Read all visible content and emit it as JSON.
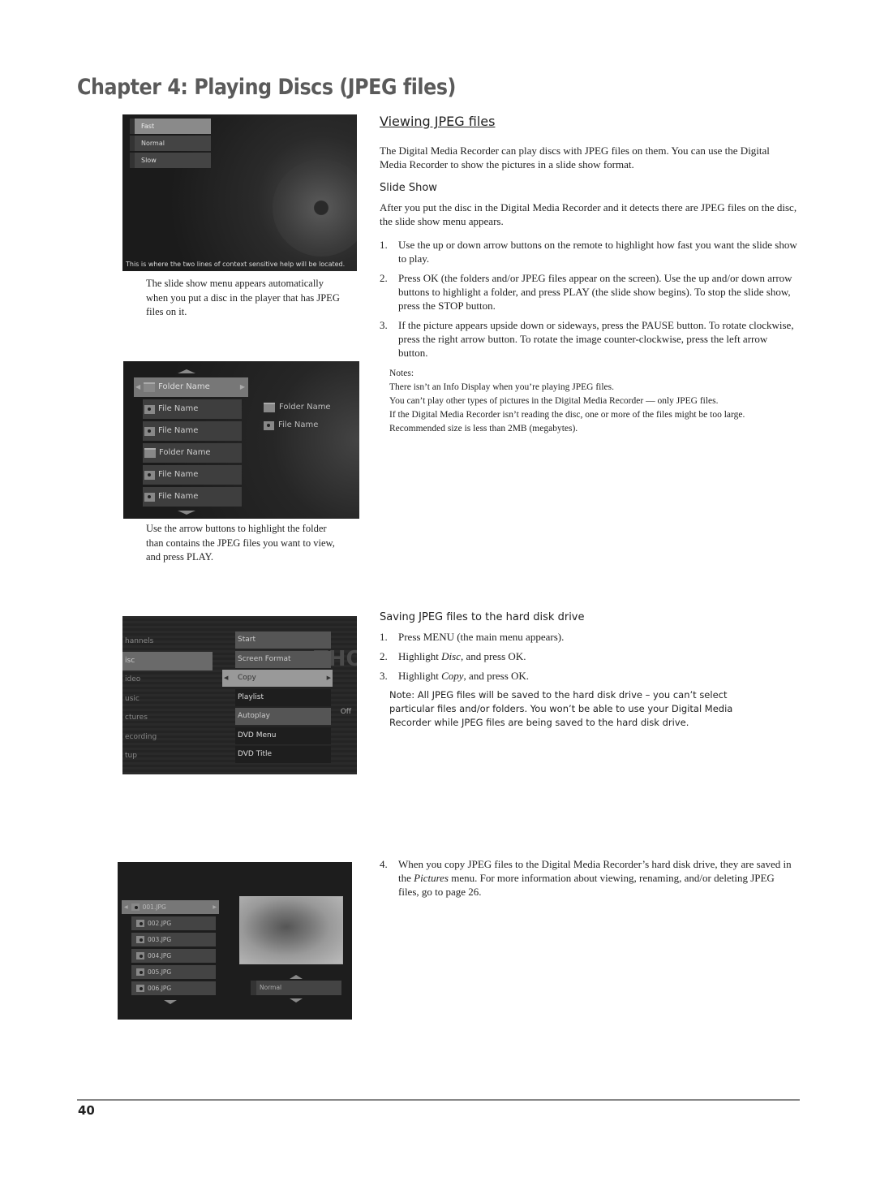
{
  "chapter_title": "Chapter 4: Playing Discs (JPEG files)",
  "section_title": "Viewing JPEG files",
  "intro": "The Digital Media Recorder can play discs with JPEG files on them. You can use the Digital Media Recorder to show the pictures in a slide show format.",
  "slide_show": {
    "heading": "Slide Show",
    "intro": "After you put the disc in the Digital Media Recorder and it detects there are JPEG files on the disc, the slide show menu appears.",
    "steps": [
      {
        "num": "1.",
        "text": "Use the up or down arrow buttons on the remote to highlight how fast you want the slide show to play."
      },
      {
        "num": "2.",
        "text": "Press OK (the folders and/or JPEG files appear on the screen). Use the up and/or down arrow buttons to highlight a folder, and press PLAY (the slide show begins). To stop the slide show, press the STOP button."
      },
      {
        "num": "3.",
        "text": "If the picture appears upside down or sideways, press the PAUSE button. To rotate clockwise, press the right arrow button. To rotate the image counter-clockwise, press the left arrow button."
      }
    ],
    "notes": [
      "Notes:",
      "There isn’t an Info Display when you’re playing JPEG files.",
      "You can’t play other types of pictures in the Digital Media Recorder — only JPEG files.",
      "If the Digital Media Recorder isn’t reading the disc, one or more of the files might be too large.",
      "Recommended size is less than 2MB (megabytes)."
    ]
  },
  "saving": {
    "heading": "Saving JPEG files to the hard disk drive",
    "steps": [
      {
        "num": "1.",
        "text": "Press MENU (the main menu appears)."
      },
      {
        "num": "2.",
        "pre": "Highlight ",
        "em": "Disc",
        "post": ", and press OK."
      },
      {
        "num": "3.",
        "pre": "Highlight ",
        "em": "Copy",
        "post": ", and press OK."
      }
    ],
    "note": "Note: All JPEG files will be saved to the hard disk drive – you can’t select particular files and/or folders. You won’t be able to use your Digital Media Recorder while JPEG files are being saved to the hard disk drive.",
    "step4": {
      "num": "4.",
      "pre": "When you copy JPEG files to the Digital Media Recorder’s hard disk drive, they are saved in the ",
      "em": "Pictures",
      "post": " menu. For more information about viewing, renaming, and/or deleting JPEG files, go to page 26."
    }
  },
  "captions": {
    "slide_show_menu": "The slide show menu appears automatically when you put a disc in the player that has JPEG files on it.",
    "folder_menu": "Use the arrow buttons to highlight the folder than contains the JPEG files you want to view, and press PLAY."
  },
  "screen1": {
    "items": [
      "Fast",
      "Normal",
      "Slow"
    ],
    "selected": 0,
    "help": "This is where the two lines of context sensitive help will be located."
  },
  "screen2": {
    "items": [
      {
        "type": "folder",
        "label": "Folder Name"
      },
      {
        "type": "file",
        "label": "File Name"
      },
      {
        "type": "file",
        "label": "File Name"
      },
      {
        "type": "folder",
        "label": "Folder Name"
      },
      {
        "type": "file",
        "label": "File Name"
      },
      {
        "type": "file",
        "label": "File Name"
      }
    ],
    "preview": [
      {
        "type": "folder",
        "label": "Folder Name"
      },
      {
        "type": "file",
        "label": "File Name"
      }
    ]
  },
  "screen3": {
    "left_items": [
      "hannels",
      "isc",
      "ideo",
      "usic",
      "ctures",
      "ecording",
      "tup"
    ],
    "left_selected": 1,
    "menu_items": [
      "Start",
      "Screen Format",
      "Copy",
      "Playlist",
      "Autoplay",
      "DVD Menu",
      "DVD Title"
    ],
    "menu_selected": 2,
    "autoplay_value": "Off",
    "background_text": "THO"
  },
  "screen4": {
    "files": [
      "001.JPG",
      "002.JPG",
      "003.JPG",
      "004.JPG",
      "005.JPG",
      "006.JPG"
    ],
    "selected": 0,
    "speed": "Normal"
  },
  "page_number": "40"
}
